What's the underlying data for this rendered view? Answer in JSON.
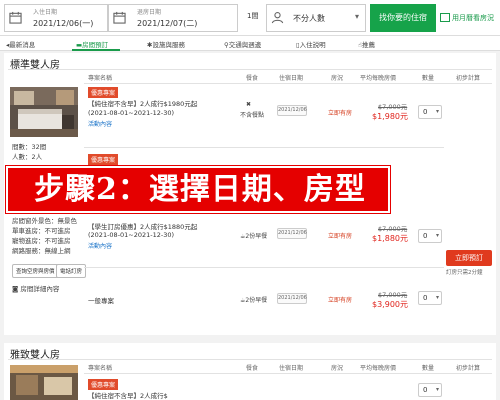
{
  "search": {
    "checkin_label": "入住日期",
    "checkin_value": "2021/12/06(一)",
    "checkout_label": "退房日期",
    "checkout_value": "2021/12/07(二)",
    "rooms_value": "1間",
    "guests_value": "不分人數",
    "find_button": "找你要的住宿",
    "vacancy_link": "用月曆看房況"
  },
  "tabs": [
    {
      "label": "最新消息",
      "icon": "megaphone-icon"
    },
    {
      "label": "房間預訂",
      "icon": "bed-icon"
    },
    {
      "label": "設施與服務",
      "icon": "gear-icon"
    },
    {
      "label": "交通與週邊",
      "icon": "map-pin-icon"
    },
    {
      "label": "入住説明",
      "icon": "document-icon"
    },
    {
      "label": "推薦",
      "icon": "thumbs-up-icon"
    }
  ],
  "columns": {
    "plan": "專案名稱",
    "meal": "餐食",
    "date": "住宿日期",
    "status": "房況",
    "avg_price": "平均每晚房價",
    "qty": "數量",
    "total": "初步計算"
  },
  "room1": {
    "title": "標準雙人房",
    "specs": [
      "間數：32間",
      "人數：2人",
      "房間窗外景色：無景色",
      "單車進房：不可進房",
      "寵物進房：不可進房",
      "網路服務：無線上網"
    ],
    "btn_photos": "查詢空房與房價",
    "btn_call": "電話訂房",
    "room_details_link": "房間詳細內容",
    "plans": [
      {
        "badge": "優惠專案",
        "name": "【純住宿不含早】2人成行$1980元起",
        "period": "(2021-08-01~2021-12-30)",
        "link": "活動內容",
        "meal": "不含餐點",
        "date": "2021/12/06",
        "status": "立即有房",
        "old_price": "$7,000元",
        "new_price": "$1,980元",
        "qty": "0"
      },
      {
        "badge": "優惠專案",
        "name": "【學生訂房優惠】2人成行$1880元起",
        "period": "(2021-08-01~2021-12-30)",
        "link": "活動內容",
        "meal": "2份早餐",
        "date": "2021/12/06",
        "status": "立即有房",
        "old_price": "$7,000元",
        "new_price": "$1,880元",
        "qty": "0"
      },
      {
        "badge": "",
        "name": "一般專案",
        "period": "",
        "link": "",
        "meal": "2份早餐",
        "date": "2021/12/06",
        "status": "立即有房",
        "old_price": "$7,000元",
        "new_price": "$3,900元",
        "qty": "0"
      }
    ],
    "book_button": "立即預訂",
    "book_note": "訂房只需2分鐘"
  },
  "room2": {
    "title": "雅致雙人房",
    "badge": "優惠專案",
    "partial_name": "【純住宿不含早】2人成行$",
    "qty": "0"
  },
  "overlay": {
    "text": "步驟2：選擇日期、房型"
  },
  "colors": {
    "brand_green": "#16a34a",
    "price_red": "#e0231c",
    "banner_red": "#e50000",
    "badge_red": "#e14b2b"
  }
}
